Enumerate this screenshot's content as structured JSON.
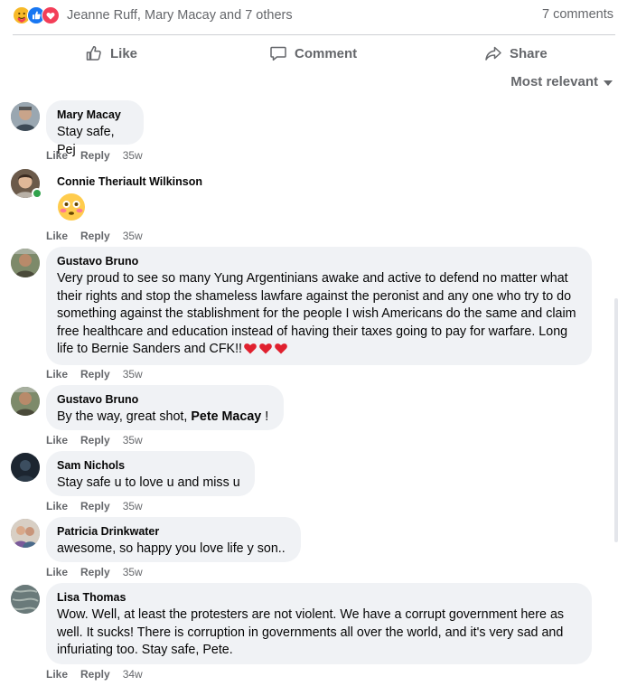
{
  "reactions": {
    "icons": [
      "care-reaction",
      "like-reaction",
      "love-reaction"
    ],
    "names_text": "Jeanne Ruff, Mary Macay and 7 others",
    "comments_count": "7 comments"
  },
  "actions": {
    "like": "Like",
    "comment": "Comment",
    "share": "Share"
  },
  "sort": {
    "label": "Most relevant"
  },
  "colors": {
    "online": "#31a24c",
    "bubble": "#f0f2f5",
    "meta": "#65676b",
    "like_blue": "#1877f2",
    "love_red": "#f33e58"
  },
  "comments": [
    {
      "author": "Mary Macay",
      "text": "Stay safe, Pej",
      "like": "Like",
      "reply": "Reply",
      "time": "35w"
    },
    {
      "author": "Connie Theriault Wilkinson",
      "emoji": "flushed-face-emoji",
      "like": "Like",
      "reply": "Reply",
      "time": "35w"
    },
    {
      "author": "Gustavo Bruno",
      "text": "Very proud to see so many Yung Argentinians awake and active to defend no matter what their rights and stop the shameless lawfare against the peronist and any one who try to do something against the stablishment for the people I wish Americans do the same and claim free healthcare and education instead of having their taxes going to pay for warfare. Long life to Bernie Sanders and CFK!!",
      "like": "Like",
      "reply": "Reply",
      "time": "35w"
    },
    {
      "author": "Gustavo Bruno",
      "text_before": "By the way, great shot, ",
      "mention": "Pete Macay",
      "text_after": " !",
      "like": "Like",
      "reply": "Reply",
      "time": "35w"
    },
    {
      "author": "Sam Nichols",
      "text": "Stay safe u to love u and miss u",
      "like": "Like",
      "reply": "Reply",
      "time": "35w"
    },
    {
      "author": "Patricia Drinkwater",
      "text": "awesome, so happy you love life y son..",
      "like": "Like",
      "reply": "Reply",
      "time": "35w"
    },
    {
      "author": "Lisa Thomas",
      "text": "Wow. Well, at least the protesters are not violent. We have a corrupt government here as well. It sucks! There is corruption in governments all over the world, and it's very sad and infuriating too. Stay safe, Pete.",
      "like": "Like",
      "reply": "Reply",
      "time": "34w"
    }
  ]
}
